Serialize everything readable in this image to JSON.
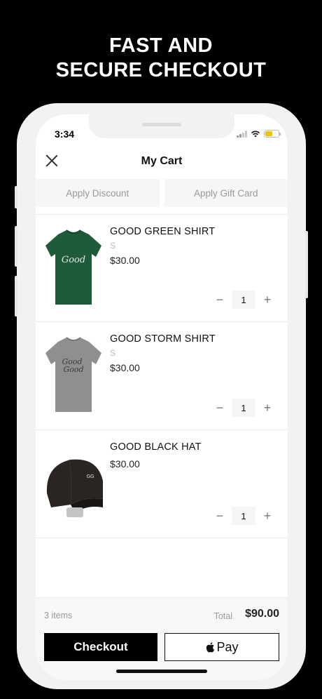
{
  "promo": {
    "line1": "FAST AND",
    "line2": "SECURE CHECKOUT"
  },
  "status_bar": {
    "time": "3:34"
  },
  "header": {
    "title": "My Cart"
  },
  "actions": {
    "apply_discount": "Apply Discount",
    "apply_gift_card": "Apply Gift Card"
  },
  "cart": {
    "items": [
      {
        "name": "GOOD GREEN SHIRT",
        "variant": "S",
        "price": "$30.00",
        "quantity": "1",
        "image": "green-tshirt",
        "color": "#1f5a3a"
      },
      {
        "name": "GOOD STORM SHIRT",
        "variant": "S",
        "price": "$30.00",
        "quantity": "1",
        "image": "gray-tshirt",
        "color": "#8f8f92"
      },
      {
        "name": "GOOD BLACK HAT",
        "variant": "",
        "price": "$30.00",
        "quantity": "1",
        "image": "black-cap",
        "color": "#2a2522"
      }
    ],
    "qty_minus": "−",
    "qty_plus": "+"
  },
  "summary": {
    "items_count": "3 items",
    "total_label": "Total",
    "total_value": "$90.00"
  },
  "buttons": {
    "checkout": "Checkout",
    "apple_pay": "Pay"
  }
}
